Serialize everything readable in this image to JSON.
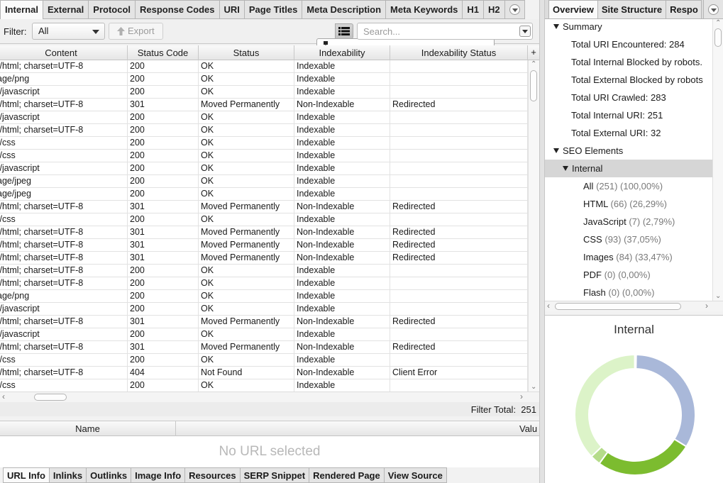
{
  "main_tabs": [
    "Internal",
    "External",
    "Protocol",
    "Response Codes",
    "URI",
    "Page Titles",
    "Meta Description",
    "Meta Keywords",
    "H1",
    "H2"
  ],
  "toolbar": {
    "filter_label": "Filter:",
    "filter_value": "All",
    "export_label": "Export",
    "search_placeholder": "Search..."
  },
  "table": {
    "headers": [
      "Content",
      "Status Code",
      "Status",
      "Indexability",
      "Indexability Status"
    ],
    "add_column_symbol": "+",
    "rows": [
      [
        "t/html; charset=UTF-8",
        "200",
        "OK",
        "Indexable",
        ""
      ],
      [
        "age/png",
        "200",
        "OK",
        "Indexable",
        ""
      ],
      [
        "t/javascript",
        "200",
        "OK",
        "Indexable",
        ""
      ],
      [
        "t/html; charset=UTF-8",
        "301",
        "Moved Permanently",
        "Non-Indexable",
        "Redirected"
      ],
      [
        "t/javascript",
        "200",
        "OK",
        "Indexable",
        ""
      ],
      [
        "t/html; charset=UTF-8",
        "200",
        "OK",
        "Indexable",
        ""
      ],
      [
        "t/css",
        "200",
        "OK",
        "Indexable",
        ""
      ],
      [
        "t/css",
        "200",
        "OK",
        "Indexable",
        ""
      ],
      [
        "t/javascript",
        "200",
        "OK",
        "Indexable",
        ""
      ],
      [
        "age/jpeg",
        "200",
        "OK",
        "Indexable",
        ""
      ],
      [
        "age/jpeg",
        "200",
        "OK",
        "Indexable",
        ""
      ],
      [
        "t/html; charset=UTF-8",
        "301",
        "Moved Permanently",
        "Non-Indexable",
        "Redirected"
      ],
      [
        "t/css",
        "200",
        "OK",
        "Indexable",
        ""
      ],
      [
        "t/html; charset=UTF-8",
        "301",
        "Moved Permanently",
        "Non-Indexable",
        "Redirected"
      ],
      [
        "t/html; charset=UTF-8",
        "301",
        "Moved Permanently",
        "Non-Indexable",
        "Redirected"
      ],
      [
        "t/html; charset=UTF-8",
        "301",
        "Moved Permanently",
        "Non-Indexable",
        "Redirected"
      ],
      [
        "t/html; charset=UTF-8",
        "200",
        "OK",
        "Indexable",
        ""
      ],
      [
        "t/html; charset=UTF-8",
        "200",
        "OK",
        "Indexable",
        ""
      ],
      [
        "age/png",
        "200",
        "OK",
        "Indexable",
        ""
      ],
      [
        "t/javascript",
        "200",
        "OK",
        "Indexable",
        ""
      ],
      [
        "t/html; charset=UTF-8",
        "301",
        "Moved Permanently",
        "Non-Indexable",
        "Redirected"
      ],
      [
        "t/javascript",
        "200",
        "OK",
        "Indexable",
        ""
      ],
      [
        "t/html; charset=UTF-8",
        "301",
        "Moved Permanently",
        "Non-Indexable",
        "Redirected"
      ],
      [
        "t/css",
        "200",
        "OK",
        "Indexable",
        ""
      ],
      [
        "t/html; charset=UTF-8",
        "404",
        "Not Found",
        "Non-Indexable",
        "Client Error"
      ],
      [
        "t/css",
        "200",
        "OK",
        "Indexable",
        ""
      ]
    ]
  },
  "filter_total": {
    "label": "Filter Total:",
    "value": "251"
  },
  "details": {
    "col_name": "Name",
    "col_value": "Valu",
    "empty_message": "No URL selected"
  },
  "bottom_tabs": [
    "URL Info",
    "Inlinks",
    "Outlinks",
    "Image Info",
    "Resources",
    "SERP Snippet",
    "Rendered Page",
    "View Source"
  ],
  "right_tabs": [
    "Overview",
    "Site Structure",
    "Respo"
  ],
  "overview": {
    "summary_label": "Summary",
    "summary_items": [
      "Total URI Encountered: 284",
      "Total Internal Blocked by robots.",
      "Total External Blocked by robots",
      "Total URI Crawled: 283",
      "Total Internal URI: 251",
      "Total External URI: 32"
    ],
    "seo_label": "SEO Elements",
    "internal_label": "Internal",
    "internal_items": [
      {
        "name": "All",
        "stats": "(251) (100,00%)"
      },
      {
        "name": "HTML",
        "stats": "(66) (26,29%)"
      },
      {
        "name": "JavaScript",
        "stats": "(7) (2,79%)"
      },
      {
        "name": "CSS",
        "stats": "(93) (37,05%)"
      },
      {
        "name": "Images",
        "stats": "(84) (33,47%)"
      },
      {
        "name": "PDF",
        "stats": "(0) (0,00%)"
      },
      {
        "name": "Flash",
        "stats": "(0) (0,00%)"
      }
    ]
  },
  "donut": {
    "title": "Internal",
    "segments": [
      {
        "fraction": 0.3347,
        "color": "#a9b8d9"
      },
      {
        "fraction": 0.2629,
        "color": "#7cbc2f"
      },
      {
        "fraction": 0.0279,
        "color": "#b5dc8a"
      },
      {
        "fraction": 0.3705,
        "color": "#dcf3c8"
      }
    ]
  },
  "colors": {
    "selected_row": "#d6d6d6",
    "placeholder_text": "#b8b8b8"
  }
}
